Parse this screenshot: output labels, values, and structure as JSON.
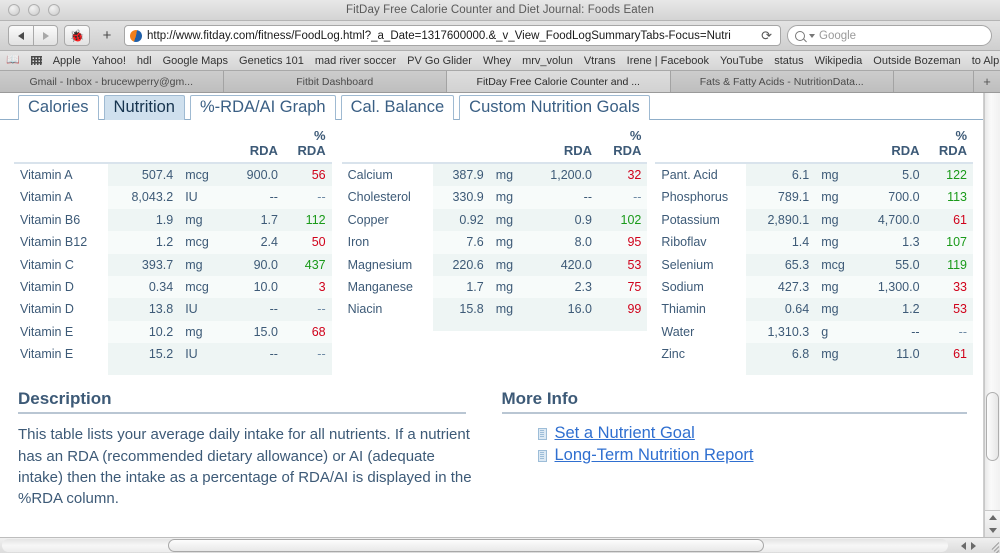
{
  "window": {
    "title": "FitDay Free Calorie Counter and Diet Journal: Foods Eaten"
  },
  "toolbar": {
    "back_icon": "back-arrow-icon",
    "forward_icon": "forward-arrow-icon",
    "bug_icon": "🐞",
    "plus_label": "+",
    "url": "http://www.fitday.com/fitness/FoodLog.html?_a_Date=1317600000.&_v_View_FoodLogSummaryTabs-Focus=Nutri",
    "reload_label": "⟳",
    "search_placeholder": "Google"
  },
  "bookmarks": [
    "Apple",
    "Yahoo!",
    "hdl",
    "Google Maps",
    "Genetics 101",
    "mad river soccer",
    "PV Go Glider",
    "Whey",
    "mrv_volun",
    "Vtrans",
    "Irene | Facebook",
    "YouTube",
    "status",
    "Wikipedia",
    "Outside Bozeman",
    "to Alp Ascen"
  ],
  "bookmarks_overflow": "»",
  "browser_tabs": [
    {
      "label": "Gmail - Inbox - brucewperry@gm...",
      "active": false
    },
    {
      "label": "Fitbit Dashboard",
      "active": false
    },
    {
      "label": "FitDay Free Calorie Counter and ...",
      "active": true
    },
    {
      "label": "Fats & Fatty Acids - NutritionData...",
      "active": false
    }
  ],
  "new_tab_label": "+",
  "site_tabs": [
    {
      "label": "Calories",
      "active": false
    },
    {
      "label": "Nutrition",
      "active": true
    },
    {
      "label": "%-RDA/AI Graph",
      "active": false
    },
    {
      "label": "Cal. Balance",
      "active": false
    },
    {
      "label": "Custom Nutrition Goals",
      "active": false
    }
  ],
  "colors": {
    "text_blue": "#3d5a77",
    "link_blue": "#2f6fd0",
    "low_pct": "#d0021b",
    "high_pct": "#1a9a1a",
    "row_shade": "#eef5f4",
    "tab_active": "#cfe0ee"
  },
  "tables": [
    {
      "id": "vitamins",
      "headers": {
        "name": "",
        "amount": "",
        "unit": "",
        "rda": "RDA",
        "pct": "% RDA"
      },
      "rows": [
        {
          "name": "Vitamin A",
          "amount": "507.4",
          "unit": "mcg",
          "rda": "900.0",
          "pct": "56",
          "state": "lo"
        },
        {
          "name": "Vitamin A",
          "amount": "8,043.2",
          "unit": "IU",
          "rda": "--",
          "pct": "--",
          "state": "na"
        },
        {
          "name": "Vitamin B6",
          "amount": "1.9",
          "unit": "mg",
          "rda": "1.7",
          "pct": "112",
          "state": "hi"
        },
        {
          "name": "Vitamin B12",
          "amount": "1.2",
          "unit": "mcg",
          "rda": "2.4",
          "pct": "50",
          "state": "lo"
        },
        {
          "name": "Vitamin C",
          "amount": "393.7",
          "unit": "mg",
          "rda": "90.0",
          "pct": "437",
          "state": "hi"
        },
        {
          "name": "Vitamin D",
          "amount": "0.34",
          "unit": "mcg",
          "rda": "10.0",
          "pct": "3",
          "state": "lo"
        },
        {
          "name": "Vitamin D",
          "amount": "13.8",
          "unit": "IU",
          "rda": "--",
          "pct": "--",
          "state": "na"
        },
        {
          "name": "Vitamin E",
          "amount": "10.2",
          "unit": "mg",
          "rda": "15.0",
          "pct": "68",
          "state": "lo"
        },
        {
          "name": "Vitamin E",
          "amount": "15.2",
          "unit": "IU",
          "rda": "--",
          "pct": "--",
          "state": "na"
        }
      ]
    },
    {
      "id": "minerals-a",
      "headers": {
        "name": "",
        "amount": "",
        "unit": "",
        "rda": "RDA",
        "pct": "% RDA"
      },
      "rows": [
        {
          "name": "Calcium",
          "amount": "387.9",
          "unit": "mg",
          "rda": "1,200.0",
          "pct": "32",
          "state": "lo"
        },
        {
          "name": "Cholesterol",
          "amount": "330.9",
          "unit": "mg",
          "rda": "--",
          "pct": "--",
          "state": "na"
        },
        {
          "name": "Copper",
          "amount": "0.92",
          "unit": "mg",
          "rda": "0.9",
          "pct": "102",
          "state": "hi"
        },
        {
          "name": "Iron",
          "amount": "7.6",
          "unit": "mg",
          "rda": "8.0",
          "pct": "95",
          "state": "lo"
        },
        {
          "name": "Magnesium",
          "amount": "220.6",
          "unit": "mg",
          "rda": "420.0",
          "pct": "53",
          "state": "lo"
        },
        {
          "name": "Manganese",
          "amount": "1.7",
          "unit": "mg",
          "rda": "2.3",
          "pct": "75",
          "state": "lo"
        },
        {
          "name": "Niacin",
          "amount": "15.8",
          "unit": "mg",
          "rda": "16.0",
          "pct": "99",
          "state": "lo"
        }
      ]
    },
    {
      "id": "minerals-b",
      "headers": {
        "name": "",
        "amount": "",
        "unit": "",
        "rda": "RDA",
        "pct": "% RDA"
      },
      "rows": [
        {
          "name": "Pant. Acid",
          "amount": "6.1",
          "unit": "mg",
          "rda": "5.0",
          "pct": "122",
          "state": "hi"
        },
        {
          "name": "Phosphorus",
          "amount": "789.1",
          "unit": "mg",
          "rda": "700.0",
          "pct": "113",
          "state": "hi"
        },
        {
          "name": "Potassium",
          "amount": "2,890.1",
          "unit": "mg",
          "rda": "4,700.0",
          "pct": "61",
          "state": "lo"
        },
        {
          "name": "Riboflav",
          "amount": "1.4",
          "unit": "mg",
          "rda": "1.3",
          "pct": "107",
          "state": "hi"
        },
        {
          "name": "Selenium",
          "amount": "65.3",
          "unit": "mcg",
          "rda": "55.0",
          "pct": "119",
          "state": "hi"
        },
        {
          "name": "Sodium",
          "amount": "427.3",
          "unit": "mg",
          "rda": "1,300.0",
          "pct": "33",
          "state": "lo"
        },
        {
          "name": "Thiamin",
          "amount": "0.64",
          "unit": "mg",
          "rda": "1.2",
          "pct": "53",
          "state": "lo"
        },
        {
          "name": "Water",
          "amount": "1,310.3",
          "unit": "g",
          "rda": "--",
          "pct": "--",
          "state": "na"
        },
        {
          "name": "Zinc",
          "amount": "6.8",
          "unit": "mg",
          "rda": "11.0",
          "pct": "61",
          "state": "lo"
        }
      ]
    }
  ],
  "description": {
    "heading": "Description",
    "body": "This table lists your average daily intake for all nutrients. If a nutrient has an RDA (recommended dietary allowance) or AI (adequate intake) then the intake as a percentage of RDA/AI is displayed in the %RDA column."
  },
  "more_info": {
    "heading": "More Info",
    "links": [
      {
        "label": "Set a Nutrient Goal"
      },
      {
        "label": "Long-Term Nutrition Report"
      }
    ]
  }
}
